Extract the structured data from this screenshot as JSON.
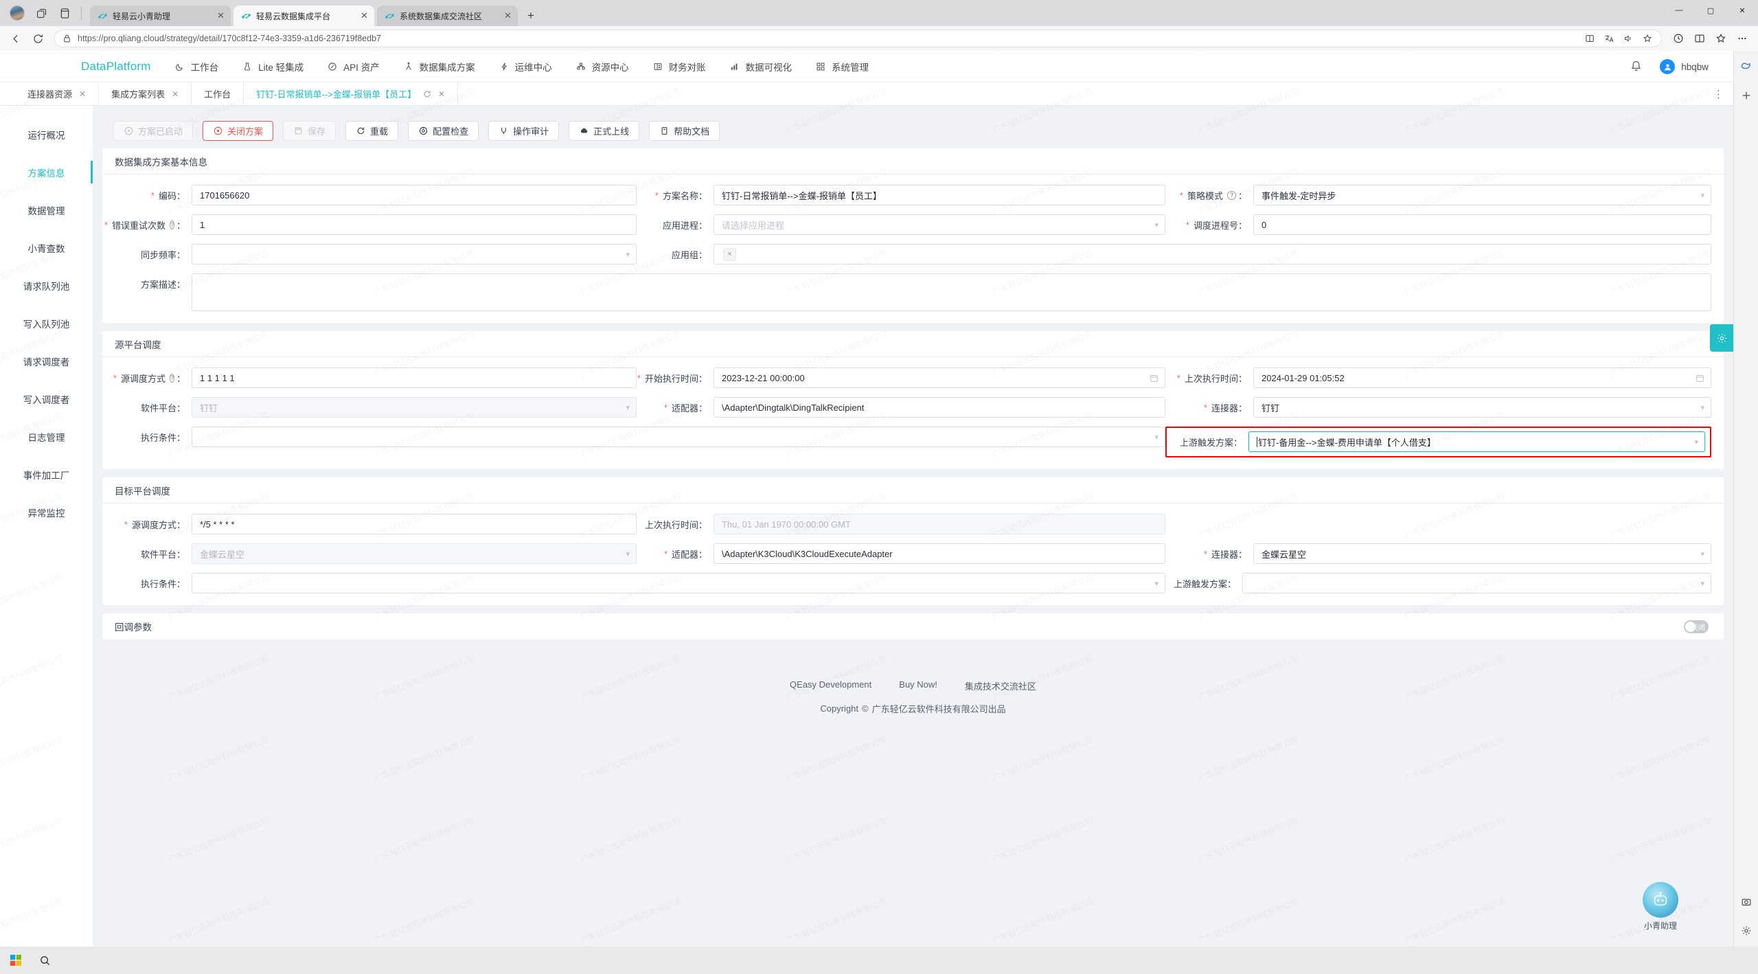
{
  "browser": {
    "tabs": [
      {
        "title": "轻易云小青助理",
        "active": false
      },
      {
        "title": "轻易云数据集成平台",
        "active": true
      },
      {
        "title": "系统数据集成交流社区",
        "active": false
      }
    ],
    "new_tab_label": "+",
    "url": "https://pro.qliang.cloud/strategy/detail/170c8f12-74e3-3359-a1d6-236719f8edb7",
    "url_host": "pro.qliang.cloud",
    "window_controls": {
      "minimize": "—",
      "maximize": "▢",
      "close": "✕"
    }
  },
  "header": {
    "brand": "DataPlatform",
    "nav": [
      {
        "label": "工作台",
        "icon": "moon-icon"
      },
      {
        "label": "Lite 轻集成",
        "icon": "beaker-icon"
      },
      {
        "label": "API 资产",
        "icon": "circle-slash-icon"
      },
      {
        "label": "数据集成方案",
        "icon": "flow-icon"
      },
      {
        "label": "运维中心",
        "icon": "bolt-icon"
      },
      {
        "label": "资源中心",
        "icon": "blocks-icon"
      },
      {
        "label": "财务对账",
        "icon": "ledger-icon"
      },
      {
        "label": "数据可视化",
        "icon": "chart-icon"
      },
      {
        "label": "系统管理",
        "icon": "grid-icon"
      }
    ],
    "notification_icon": "bell-icon",
    "user": "hbqbw"
  },
  "inner_tabs": [
    {
      "label": "连接器资源",
      "closable": true,
      "active": false
    },
    {
      "label": "集成方案列表",
      "closable": true,
      "active": false
    },
    {
      "label": "工作台",
      "closable": false,
      "active": false
    },
    {
      "label": "钉钉-日常报销单-->金蝶-报销单【员工】",
      "closable": true,
      "refresh": true,
      "active": true
    }
  ],
  "sidebar": {
    "items": [
      {
        "label": "运行概况",
        "active": false
      },
      {
        "label": "方案信息",
        "active": true
      },
      {
        "label": "数据管理",
        "active": false
      },
      {
        "label": "小青查数",
        "active": false
      },
      {
        "label": "请求队列池",
        "active": false
      },
      {
        "label": "写入队列池",
        "active": false
      },
      {
        "label": "请求调度者",
        "active": false
      },
      {
        "label": "写入调度者",
        "active": false
      },
      {
        "label": "日志管理",
        "active": false
      },
      {
        "label": "事件加工厂",
        "active": false
      },
      {
        "label": "异常监控",
        "active": false
      }
    ]
  },
  "toolbar": {
    "buttons": [
      {
        "label": "方案已启动",
        "icon": "play-circle-icon",
        "state": "disabled"
      },
      {
        "label": "关闭方案",
        "icon": "stop-circle-icon",
        "state": "danger"
      },
      {
        "label": "保存",
        "icon": "save-icon",
        "state": "disabled"
      },
      {
        "label": "重载",
        "icon": "reload-icon",
        "state": "normal"
      },
      {
        "label": "配置检查",
        "icon": "inspect-icon",
        "state": "normal"
      },
      {
        "label": "操作审计",
        "icon": "audit-icon",
        "state": "normal"
      },
      {
        "label": "正式上线",
        "icon": "cloud-upload-icon",
        "state": "normal"
      },
      {
        "label": "帮助文档",
        "icon": "doc-icon",
        "state": "normal"
      }
    ]
  },
  "basic_info": {
    "title": "数据集成方案基本信息",
    "code": {
      "label": "编码：",
      "value": "1701656620",
      "required": true
    },
    "plan_name": {
      "label": "方案名称：",
      "value": "钉钉-日常报销单-->金蝶-报销单【员工】",
      "required": true
    },
    "strategy_mode": {
      "label": "策略模式",
      "value": "事件触发-定时异步",
      "required": true,
      "help": true
    },
    "retry_count": {
      "label": "错误重试次数",
      "value": "1",
      "required": true,
      "help": true
    },
    "app_process": {
      "label": "应用进程：",
      "placeholder": "请选择应用进程",
      "value": "",
      "required": false
    },
    "schedule_process_no": {
      "label": "调度进程号：",
      "value": "0",
      "required": true
    },
    "sync_freq": {
      "label": "同步频率：",
      "value": "",
      "required": false
    },
    "app_group": {
      "label": "应用组：",
      "value": "",
      "chip": "×",
      "required": false
    },
    "description": {
      "label": "方案描述：",
      "value": "",
      "required": false
    }
  },
  "source_schedule": {
    "title": "源平台调度",
    "schedule_mode": {
      "label": "源调度方式",
      "value": "1 1 1 1 1",
      "required": true,
      "help": true
    },
    "start_time": {
      "label": "开始执行时间：",
      "value": "2023-12-21 00:00:00",
      "required": true
    },
    "last_time": {
      "label": "上次执行时间：",
      "value": "2024-01-29 01:05:52",
      "required": true
    },
    "software_platform": {
      "label": "软件平台：",
      "value": "钉钉",
      "disabled": true
    },
    "adapter": {
      "label": "适配器：",
      "value": "\\Adapter\\Dingtalk\\DingTalkRecipient",
      "required": true
    },
    "connector": {
      "label": "连接器：",
      "value": "钉钉",
      "required": true
    },
    "exec_condition": {
      "label": "执行条件：",
      "value": ""
    },
    "upstream_trigger": {
      "label": "上游触发方案：",
      "value": "钉钉-备用金-->金蝶-费用申请单【个人借支】",
      "highlighted": true,
      "focused": true
    }
  },
  "target_schedule": {
    "title": "目标平台调度",
    "schedule_mode": {
      "label": "源调度方式：",
      "value": "*/5 * * * *",
      "required": true
    },
    "last_time": {
      "label": "上次执行时间：",
      "value": "Thu, 01 Jan 1970 00:00:00 GMT",
      "disabled": true
    },
    "software_platform": {
      "label": "软件平台：",
      "value": "金蝶云星空",
      "disabled": true
    },
    "adapter": {
      "label": "适配器：",
      "value": "\\Adapter\\K3Cloud\\K3CloudExecuteAdapter",
      "required": true
    },
    "connector": {
      "label": "连接器：",
      "value": "金蝶云星空",
      "required": true
    },
    "exec_condition": {
      "label": "执行条件：",
      "value": ""
    },
    "upstream_trigger": {
      "label": "上游触发方案：",
      "value": ""
    }
  },
  "callback": {
    "title": "回调参数",
    "toggle_label": "关闭",
    "toggle_on": false
  },
  "footer": {
    "links": [
      "QEasy Development",
      "Buy Now!",
      "集成技术交流社区"
    ],
    "copyright_prefix": "Copyright",
    "copyright_symbol": "©",
    "copyright_text": "广东轻亿云软件科技有限公司出品"
  },
  "assistant": {
    "label": "小青助理"
  },
  "watermark": "广东轻亿云软件科技有限公司",
  "colors": {
    "brand": "#20c0c8",
    "danger": "#f5534f",
    "required": "#f56c6c",
    "highlight": "#ff0000"
  }
}
